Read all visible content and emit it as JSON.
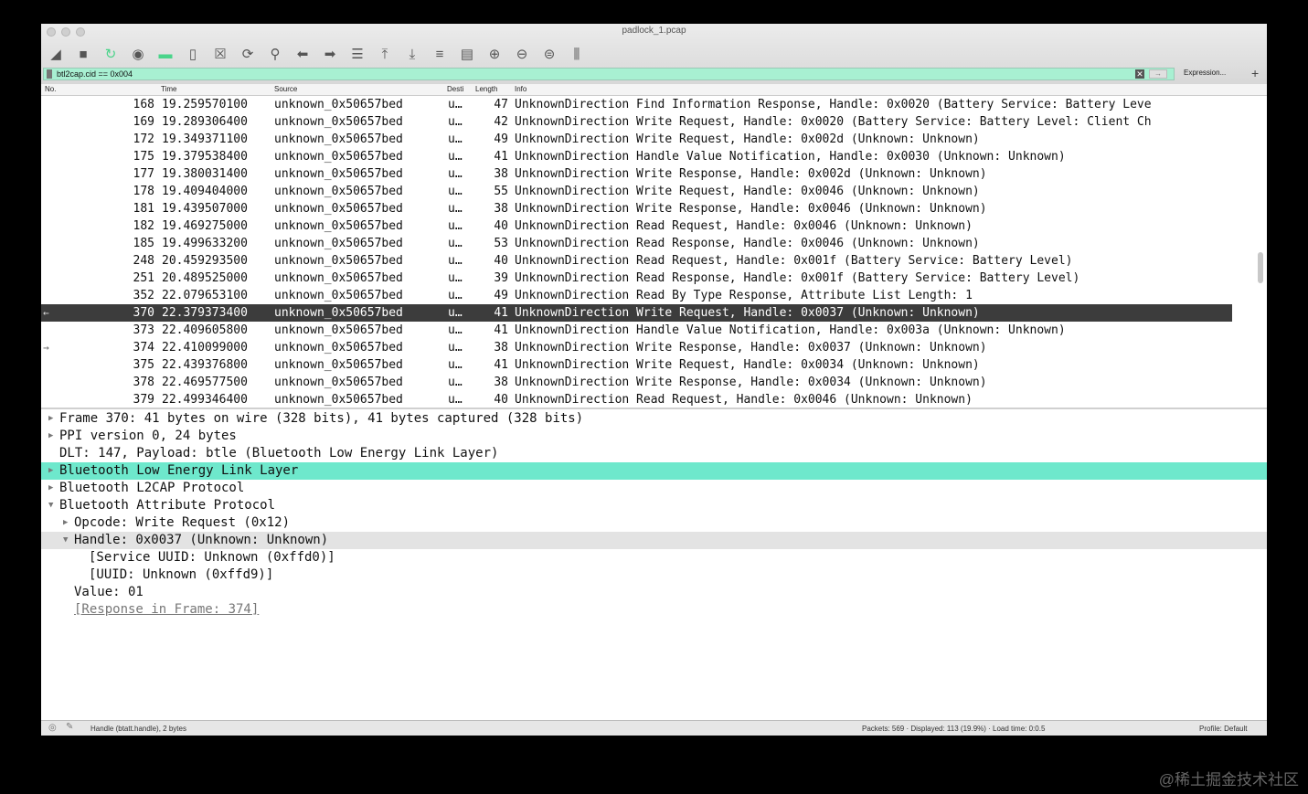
{
  "window": {
    "title": "padlock_1.pcap"
  },
  "toolbar": {
    "icons": [
      "shark-fin-icon",
      "stop-icon",
      "restart-icon",
      "options-icon",
      "open-folder-icon",
      "save-icon",
      "close-file-icon",
      "reload-icon",
      "find-icon",
      "go-back-icon",
      "go-forward-icon",
      "go-to-packet-icon",
      "first-packet-icon",
      "last-packet-icon",
      "autoscroll-icon",
      "colorize-icon",
      "zoom-in-icon",
      "zoom-out-icon",
      "zoom-reset-icon",
      "resize-columns-icon"
    ]
  },
  "filter": {
    "value": "btl2cap.cid == 0x004",
    "expression_label": "Expression...",
    "add_label": "+"
  },
  "columns": {
    "no": "No.",
    "time": "Time",
    "source": "Source",
    "destination": "Desti",
    "length": "Length",
    "info": "Info"
  },
  "packets": [
    {
      "no": "168",
      "time": "19.259570100",
      "src": "unknown_0x50657bed",
      "dst": "u…",
      "len": "47",
      "info": "UnknownDirection Find Information Response, Handle: 0x0020 (Battery Service: Battery Leve"
    },
    {
      "no": "169",
      "time": "19.289306400",
      "src": "unknown_0x50657bed",
      "dst": "u…",
      "len": "42",
      "info": "UnknownDirection Write Request, Handle: 0x0020 (Battery Service: Battery Level: Client Ch"
    },
    {
      "no": "172",
      "time": "19.349371100",
      "src": "unknown_0x50657bed",
      "dst": "u…",
      "len": "49",
      "info": "UnknownDirection Write Request, Handle: 0x002d (Unknown: Unknown)"
    },
    {
      "no": "175",
      "time": "19.379538400",
      "src": "unknown_0x50657bed",
      "dst": "u…",
      "len": "41",
      "info": "UnknownDirection Handle Value Notification, Handle: 0x0030 (Unknown: Unknown)"
    },
    {
      "no": "177",
      "time": "19.380031400",
      "src": "unknown_0x50657bed",
      "dst": "u…",
      "len": "38",
      "info": "UnknownDirection Write Response, Handle: 0x002d (Unknown: Unknown)"
    },
    {
      "no": "178",
      "time": "19.409404000",
      "src": "unknown_0x50657bed",
      "dst": "u…",
      "len": "55",
      "info": "UnknownDirection Write Request, Handle: 0x0046 (Unknown: Unknown)"
    },
    {
      "no": "181",
      "time": "19.439507000",
      "src": "unknown_0x50657bed",
      "dst": "u…",
      "len": "38",
      "info": "UnknownDirection Write Response, Handle: 0x0046 (Unknown: Unknown)"
    },
    {
      "no": "182",
      "time": "19.469275000",
      "src": "unknown_0x50657bed",
      "dst": "u…",
      "len": "40",
      "info": "UnknownDirection Read Request, Handle: 0x0046 (Unknown: Unknown)"
    },
    {
      "no": "185",
      "time": "19.499633200",
      "src": "unknown_0x50657bed",
      "dst": "u…",
      "len": "53",
      "info": "UnknownDirection Read Response, Handle: 0x0046 (Unknown: Unknown)"
    },
    {
      "no": "248",
      "time": "20.459293500",
      "src": "unknown_0x50657bed",
      "dst": "u…",
      "len": "40",
      "info": "UnknownDirection Read Request, Handle: 0x001f (Battery Service: Battery Level)"
    },
    {
      "no": "251",
      "time": "20.489525000",
      "src": "unknown_0x50657bed",
      "dst": "u…",
      "len": "39",
      "info": "UnknownDirection Read Response, Handle: 0x001f (Battery Service: Battery Level)"
    },
    {
      "no": "352",
      "time": "22.079653100",
      "src": "unknown_0x50657bed",
      "dst": "u…",
      "len": "49",
      "info": "UnknownDirection Read By Type Response, Attribute List Length: 1"
    },
    {
      "no": "370",
      "time": "22.379373400",
      "src": "unknown_0x50657bed",
      "dst": "u…",
      "len": "41",
      "info": "UnknownDirection Write Request, Handle: 0x0037 (Unknown: Unknown)",
      "selected": true,
      "marker": "←"
    },
    {
      "no": "373",
      "time": "22.409605800",
      "src": "unknown_0x50657bed",
      "dst": "u…",
      "len": "41",
      "info": "UnknownDirection Handle Value Notification, Handle: 0x003a (Unknown: Unknown)"
    },
    {
      "no": "374",
      "time": "22.410099000",
      "src": "unknown_0x50657bed",
      "dst": "u…",
      "len": "38",
      "info": "UnknownDirection Write Response, Handle: 0x0037 (Unknown: Unknown)",
      "marker": "→"
    },
    {
      "no": "375",
      "time": "22.439376800",
      "src": "unknown_0x50657bed",
      "dst": "u…",
      "len": "41",
      "info": "UnknownDirection Write Request, Handle: 0x0034 (Unknown: Unknown)"
    },
    {
      "no": "378",
      "time": "22.469577500",
      "src": "unknown_0x50657bed",
      "dst": "u…",
      "len": "38",
      "info": "UnknownDirection Write Response, Handle: 0x0034 (Unknown: Unknown)"
    },
    {
      "no": "379",
      "time": "22.499346400",
      "src": "unknown_0x50657bed",
      "dst": "u…",
      "len": "40",
      "info": "UnknownDirection Read Request, Handle: 0x0046 (Unknown: Unknown)"
    }
  ],
  "details": [
    {
      "text": "Frame 370: 41 bytes on wire (328 bits), 41 bytes captured (328 bits)",
      "level": 0,
      "expander": "collapsed"
    },
    {
      "text": "PPI version 0, 24 bytes",
      "level": 0,
      "expander": "collapsed"
    },
    {
      "text": "DLT: 147, Payload: btle (Bluetooth Low Energy Link Layer)",
      "level": 0,
      "expander": "none"
    },
    {
      "text": "Bluetooth Low Energy Link Layer",
      "level": 0,
      "expander": "collapsed",
      "state": "selected"
    },
    {
      "text": "Bluetooth L2CAP Protocol",
      "level": 0,
      "expander": "collapsed"
    },
    {
      "text": "Bluetooth Attribute Protocol",
      "level": 0,
      "expander": "expanded"
    },
    {
      "text": "Opcode: Write Request (0x12)",
      "level": 1,
      "expander": "collapsed"
    },
    {
      "text": "Handle: 0x0037 (Unknown: Unknown)",
      "level": 1,
      "expander": "expanded",
      "state": "highlighted"
    },
    {
      "text": "[Service UUID: Unknown (0xffd0)]",
      "level": 2,
      "expander": "none"
    },
    {
      "text": "[UUID: Unknown (0xffd9)]",
      "level": 2,
      "expander": "none"
    },
    {
      "text": "Value: 01",
      "level": 1,
      "expander": "none"
    },
    {
      "text": "[Response in Frame: 374]",
      "level": 1,
      "expander": "none",
      "link": true
    }
  ],
  "status": {
    "field": "Handle (btatt.handle), 2 bytes",
    "stats": "Packets: 569 · Displayed: 113 (19.9%) · Load time: 0:0.5",
    "profile": "Profile: Default"
  },
  "watermark": "@稀土掘金技术社区",
  "colors": {
    "filter_bg": "#a8f0d2",
    "selected_packet_bg": "#3c3c3c",
    "selected_detail_bg": "#6ee8cc"
  }
}
